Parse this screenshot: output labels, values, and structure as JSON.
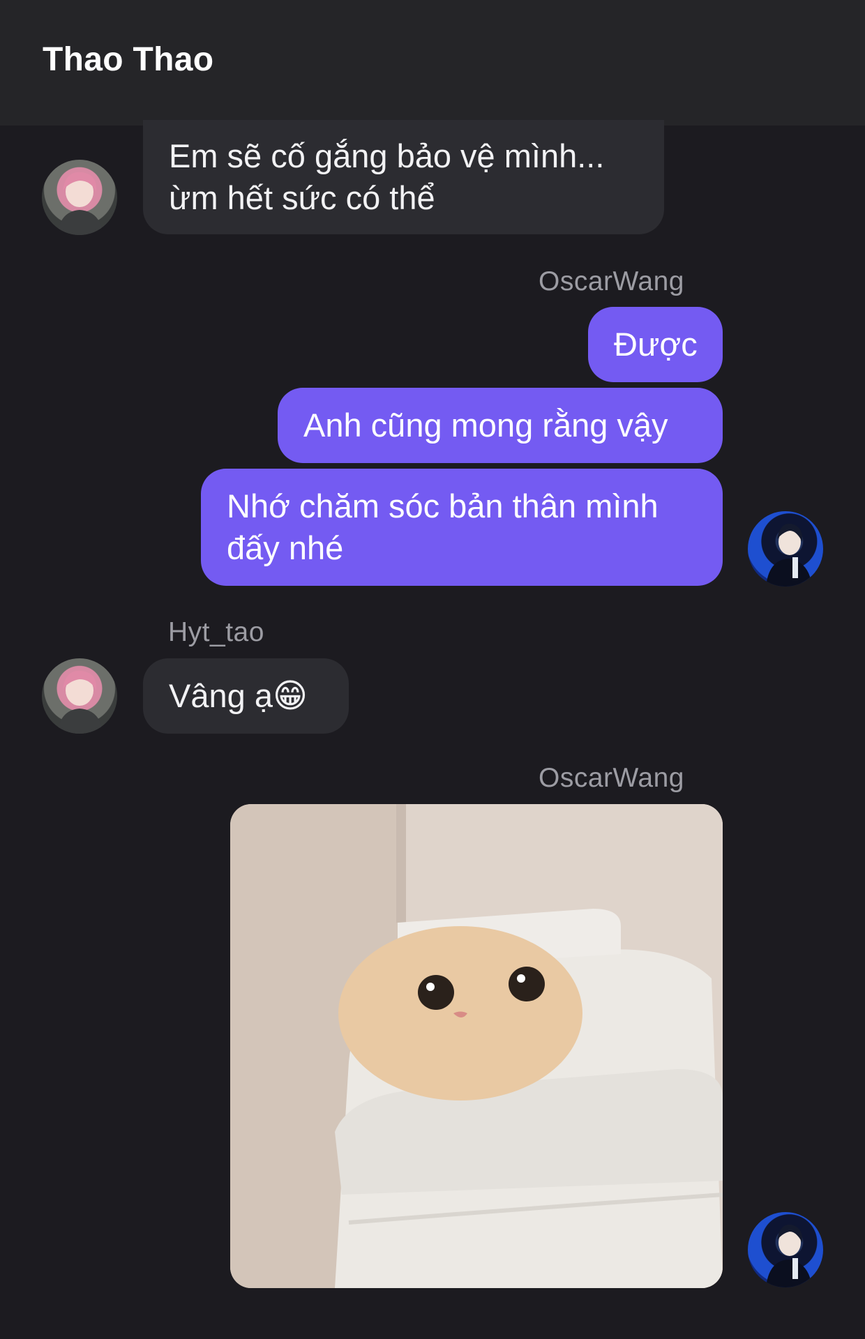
{
  "header": {
    "title": "Thao Thao"
  },
  "messages": [
    {
      "side": "in",
      "text_lines": [
        "Em sẽ cố gắng bảo vệ mình...",
        "ừm hết sức có thể"
      ]
    },
    {
      "side": "out",
      "sender": "OscarWang",
      "texts": [
        "Được",
        "Anh cũng mong rằng vậy"
      ],
      "text_lines": [
        "Nhớ chăm sóc bản thân mình",
        "đấy nhé"
      ]
    },
    {
      "side": "in",
      "sender": "Hyt_tao",
      "text": "Vâng ạ",
      "emoji": "😁"
    },
    {
      "side": "out",
      "sender": "OscarWang",
      "attachment": "cat-in-trash-bin-photo"
    }
  ],
  "colors": {
    "background": "#1c1b20",
    "header": "#252528",
    "incoming_bubble": "#2c2c31",
    "outgoing_bubble": "#745bf2",
    "sender_text": "#9c9ca3"
  }
}
